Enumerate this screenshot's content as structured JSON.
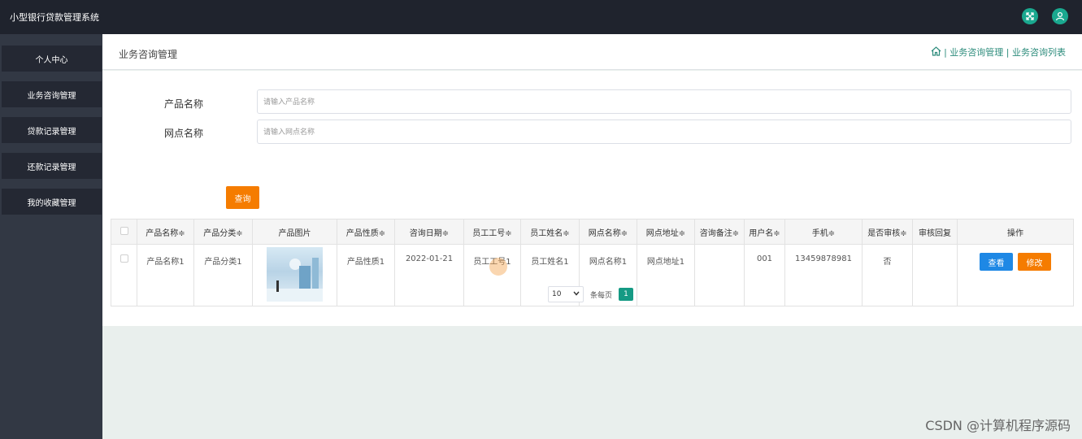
{
  "app": {
    "title": "小型银行贷款管理系统"
  },
  "topbar": {
    "icons": [
      "exit-fullscreen-icon",
      "user-icon"
    ]
  },
  "sidebar": {
    "items": [
      {
        "label": "个人中心"
      },
      {
        "label": "业务咨询管理"
      },
      {
        "label": "贷款记录管理"
      },
      {
        "label": "还款记录管理"
      },
      {
        "label": "我的收藏管理"
      }
    ]
  },
  "header": {
    "title": "业务咨询管理",
    "breadcrumb": "| 业务咨询管理 | 业务咨询列表"
  },
  "search": {
    "product_label": "产品名称",
    "product_placeholder": "请输入产品名称",
    "branch_label": "网点名称",
    "branch_placeholder": "请输入网点名称",
    "button_label": "查询"
  },
  "table": {
    "columns": [
      "产品名称≑",
      "产品分类≑",
      "产品图片",
      "产品性质≑",
      "咨询日期≑",
      "员工工号≑",
      "员工姓名≑",
      "网点名称≑",
      "网点地址≑",
      "咨询备注≑",
      "用户名≑",
      "手机≑",
      "是否审核≑",
      "审核回复",
      "操作"
    ],
    "rows": [
      {
        "product_name": "产品名称1",
        "category": "产品分类1",
        "nature": "产品性质1",
        "date": "2022-01-21",
        "staff_id": "员工工号1",
        "staff_name": "员工姓名1",
        "branch_name": "网点名称1",
        "branch_address": "网点地址1",
        "remark": "",
        "username": "001",
        "phone": "13459878981",
        "reviewed": "否",
        "reply": ""
      }
    ],
    "view_label": "查看",
    "edit_label": "修改"
  },
  "pagination": {
    "page_size": "10",
    "per_page_label": "条每页",
    "current_page": "1"
  },
  "watermark": "CSDN @计算机程序源码",
  "colors": {
    "accent": "#159a84",
    "topbar": "#1f232d",
    "sidebar": "#323844",
    "orange": "#f57c00",
    "blue": "#1e88e5"
  }
}
